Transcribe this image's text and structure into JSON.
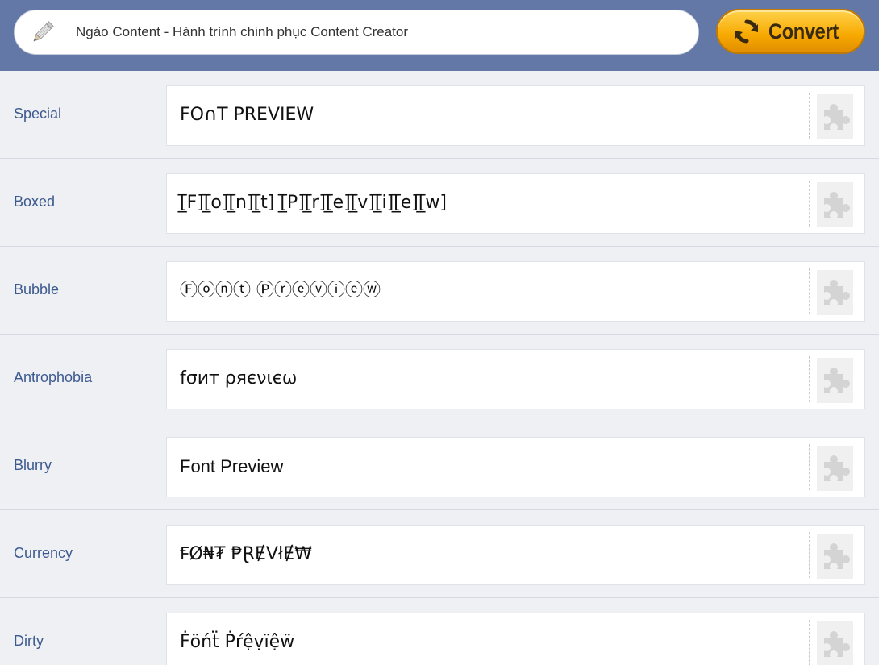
{
  "header": {
    "input_value": "Ngáo Content - Hành trình chinh phục Content Creator",
    "convert_label": "Convert",
    "pencil_icon": "pencil-icon",
    "convert_icon": "refresh-icon"
  },
  "colors": {
    "header_bg": "#6378a6",
    "row_bg": "#eef0f4",
    "label_color": "#3d5a8f",
    "button_orange": "#f7a800"
  },
  "styles": [
    {
      "name": "Special",
      "preview": "FO∩T PREVIEW",
      "icon": "puzzle-icon"
    },
    {
      "name": "Boxed",
      "preview": "[̲̅F][̲̅o][̲̅n][̲̅t] [̲̅P][̲̅r][̲̅e][̲̅v][̲̅i][̲̅e][̲̅w]",
      "icon": "puzzle-icon"
    },
    {
      "name": "Bubble",
      "preview": "Ⓕⓞⓝⓣ Ⓟⓡⓔⓥⓘⓔⓦ",
      "icon": "puzzle-icon"
    },
    {
      "name": "Antrophobia",
      "preview": "fσит ρяєνιєω",
      "icon": "puzzle-icon"
    },
    {
      "name": "Blurry",
      "preview": "Font Preview",
      "icon": "puzzle-icon"
    },
    {
      "name": "Currency",
      "preview": "ꞘØ₦₮ ₱ⱤɆVłɆ₩",
      "icon": "puzzle-icon"
    },
    {
      "name": "Dirty",
      "preview": "Ḟöńẗ Ṗŕệṿïệẅ",
      "icon": "puzzle-icon"
    }
  ]
}
